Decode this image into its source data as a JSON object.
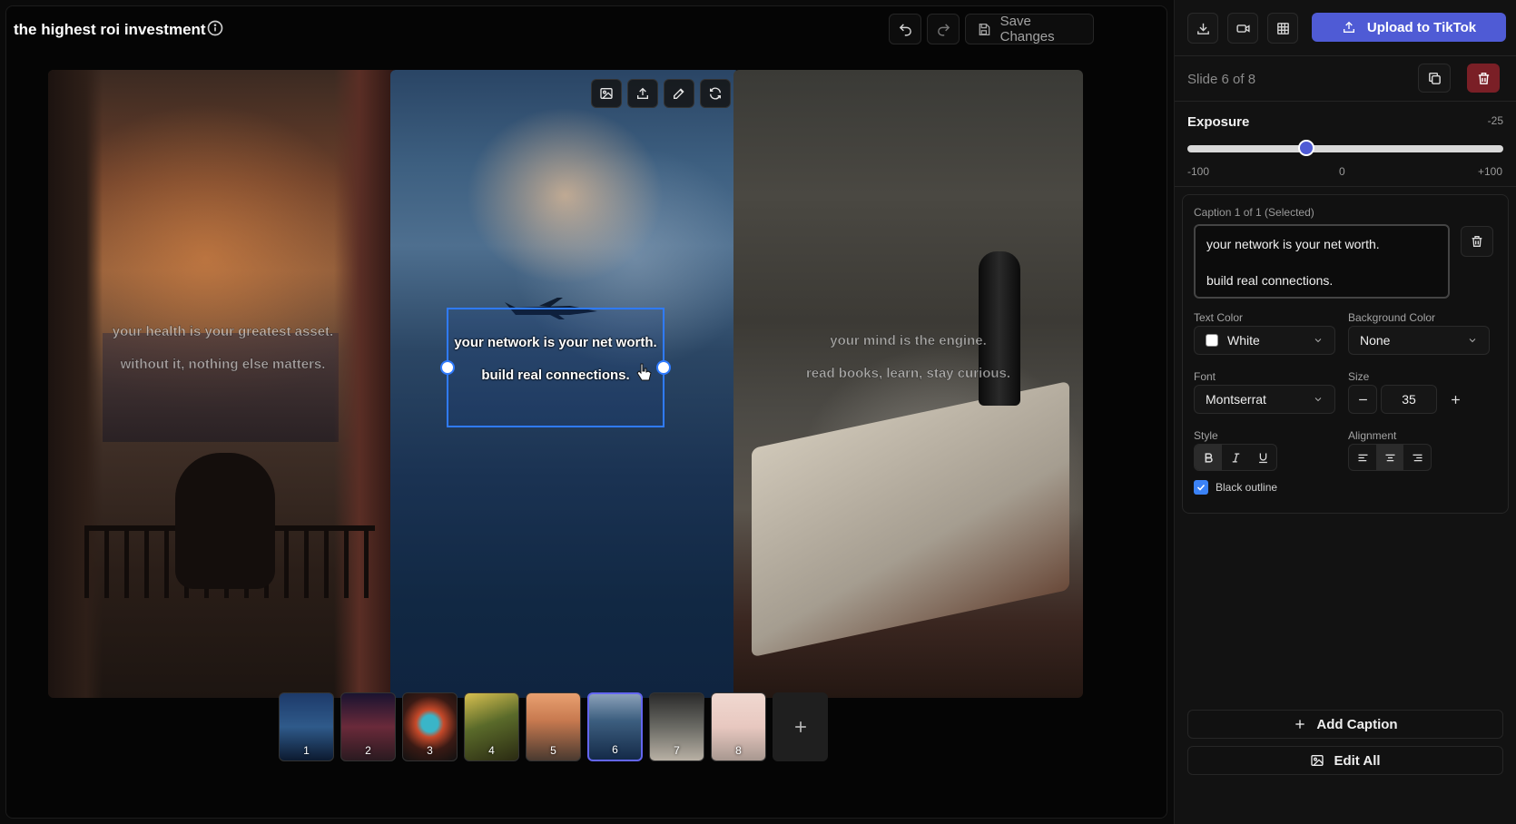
{
  "header": {
    "title": "the highest roi investment",
    "save_label": "Save Changes"
  },
  "slides": [
    {
      "caption_1": "your health is your greatest asset.",
      "caption_2": "without it, nothing else matters."
    },
    {
      "caption_1": "your network is your net worth.",
      "caption_2": "build real connections."
    },
    {
      "caption_1": "your mind is the engine.",
      "caption_2": "read books, learn, stay curious."
    }
  ],
  "thumbnails": [
    "1",
    "2",
    "3",
    "4",
    "5",
    "6",
    "7",
    "8"
  ],
  "thumbnail_selected": 6,
  "panel": {
    "upload_label": "Upload to TikTok",
    "slide_count": "Slide 6 of 8",
    "exposure": {
      "label": "Exposure",
      "value": "-25",
      "min_label": "-100",
      "mid_label": "0",
      "max_label": "+100",
      "value_number": -25
    },
    "caption": {
      "header": "Caption 1 of 1 (Selected)",
      "text": "your network is your net worth.\n\nbuild real connections.",
      "text_color_label": "Text Color",
      "text_color_value": "White",
      "bg_color_label": "Background Color",
      "bg_color_value": "None",
      "font_label": "Font",
      "font_value": "Montserrat",
      "size_label": "Size",
      "size_value": "35",
      "style_label": "Style",
      "alignment_label": "Alignment",
      "outline_label": "Black outline",
      "outline_checked": true
    },
    "add_caption_label": "Add Caption",
    "edit_all_label": "Edit All"
  },
  "colors": {
    "accent": "#4f5bd5",
    "selection": "#2f7bff",
    "danger": "#7a1f26"
  }
}
